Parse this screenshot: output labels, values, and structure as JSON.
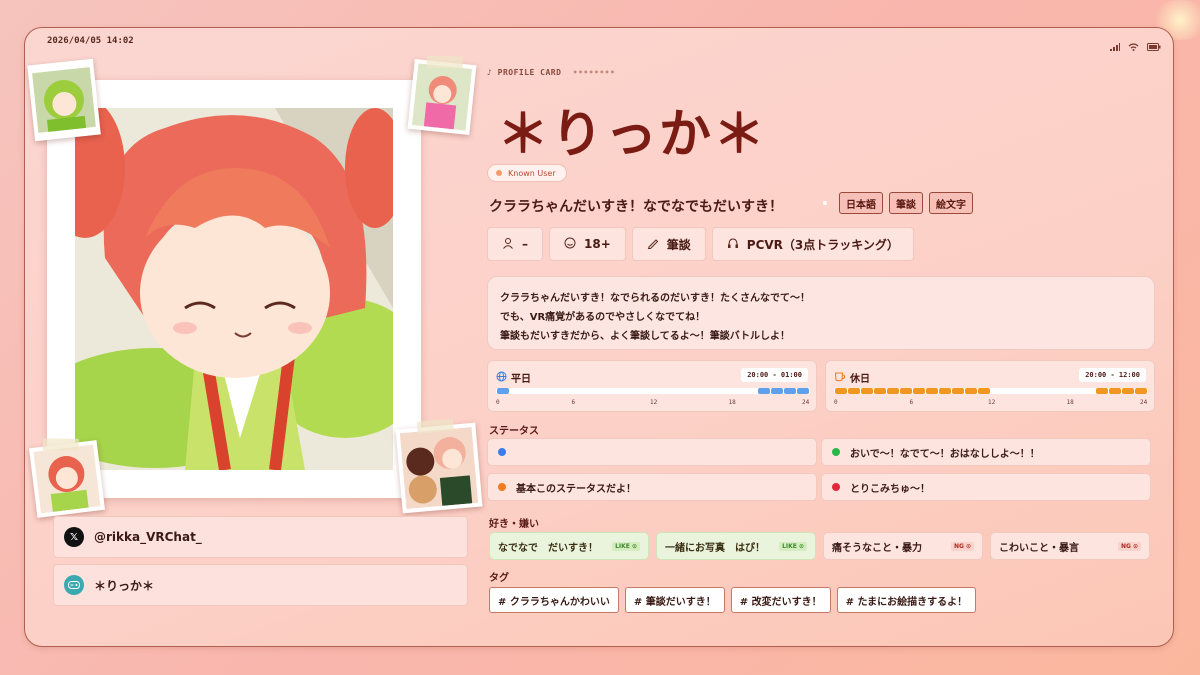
{
  "status_bar": {
    "datetime": "2026/04/05 14:02"
  },
  "header": {
    "section_label": "PROFILE CARD",
    "decor_dots": "••••••••",
    "name": "＊りっか＊",
    "known_badge": "Known User",
    "tagline": "クララちゃんだいすき！なでなでもだいすき！",
    "languages": [
      "日本語",
      "筆談",
      "絵文字"
    ]
  },
  "meta": {
    "pronoun": "–",
    "age": "18+",
    "communication": "筆談",
    "platform": "PCVR（3点トラッキング）"
  },
  "bio": {
    "lines": [
      "クララちゃんだいすき！なでられるのだいすき！たくさんなでて～！",
      "でも、VR痛覚があるのでやさしくなでてね！",
      "筆談もだいすきだから、よく筆談してるよ～！筆談バトルしよ！"
    ]
  },
  "schedule": {
    "weekday": {
      "label": "平日",
      "time": "20:00 - 01:00",
      "ranges": [
        [
          0,
          1
        ],
        [
          20,
          24
        ]
      ],
      "color": "#5fa0ec"
    },
    "holiday": {
      "label": "休日",
      "time": "20:00 - 12:00",
      "ranges": [
        [
          0,
          12
        ],
        [
          20,
          24
        ]
      ],
      "color": "#f09722"
    },
    "ticks": [
      "0",
      "6",
      "12",
      "18",
      "24"
    ]
  },
  "status": {
    "title": "ステータス",
    "items": [
      {
        "color": "#3d7be8",
        "text": ""
      },
      {
        "color": "#28b84a",
        "text": "おいで～！なでて～！おはなししよ～！！"
      },
      {
        "color": "#f07a20",
        "text": "基本このステータスだよ！"
      },
      {
        "color": "#e0283a",
        "text": "とりこみちゅ～！"
      }
    ]
  },
  "likes": {
    "title": "好き・嫌い",
    "items": [
      {
        "text": "なでなで　だいすき！",
        "badge": "LIKE ⊙",
        "kind": "like"
      },
      {
        "text": "一緒にお写真　はぴ！",
        "badge": "LIKE ⊙",
        "kind": "like"
      },
      {
        "text": "痛そうなこと・暴力",
        "badge": "NG ⊙",
        "kind": "ng"
      },
      {
        "text": "こわいこと・暴言",
        "badge": "NG ⊙",
        "kind": "ng"
      }
    ]
  },
  "tags": {
    "title": "タグ",
    "items": [
      "# クララちゃんかわいい",
      "# 筆談だいすき！",
      "# 改変だいすき！",
      "# たまにお絵描きするよ！"
    ]
  },
  "links": {
    "x_handle": "@rikka_VRChat_",
    "vrchat_name": "＊りっか＊"
  },
  "icons": [
    "signal-icon",
    "wifi-icon",
    "battery-icon",
    "music-note-icon",
    "person-icon",
    "smile-icon",
    "pen-icon",
    "headphones-icon",
    "globe-icon",
    "cup-icon",
    "x-logo-icon",
    "gamepad-icon"
  ]
}
